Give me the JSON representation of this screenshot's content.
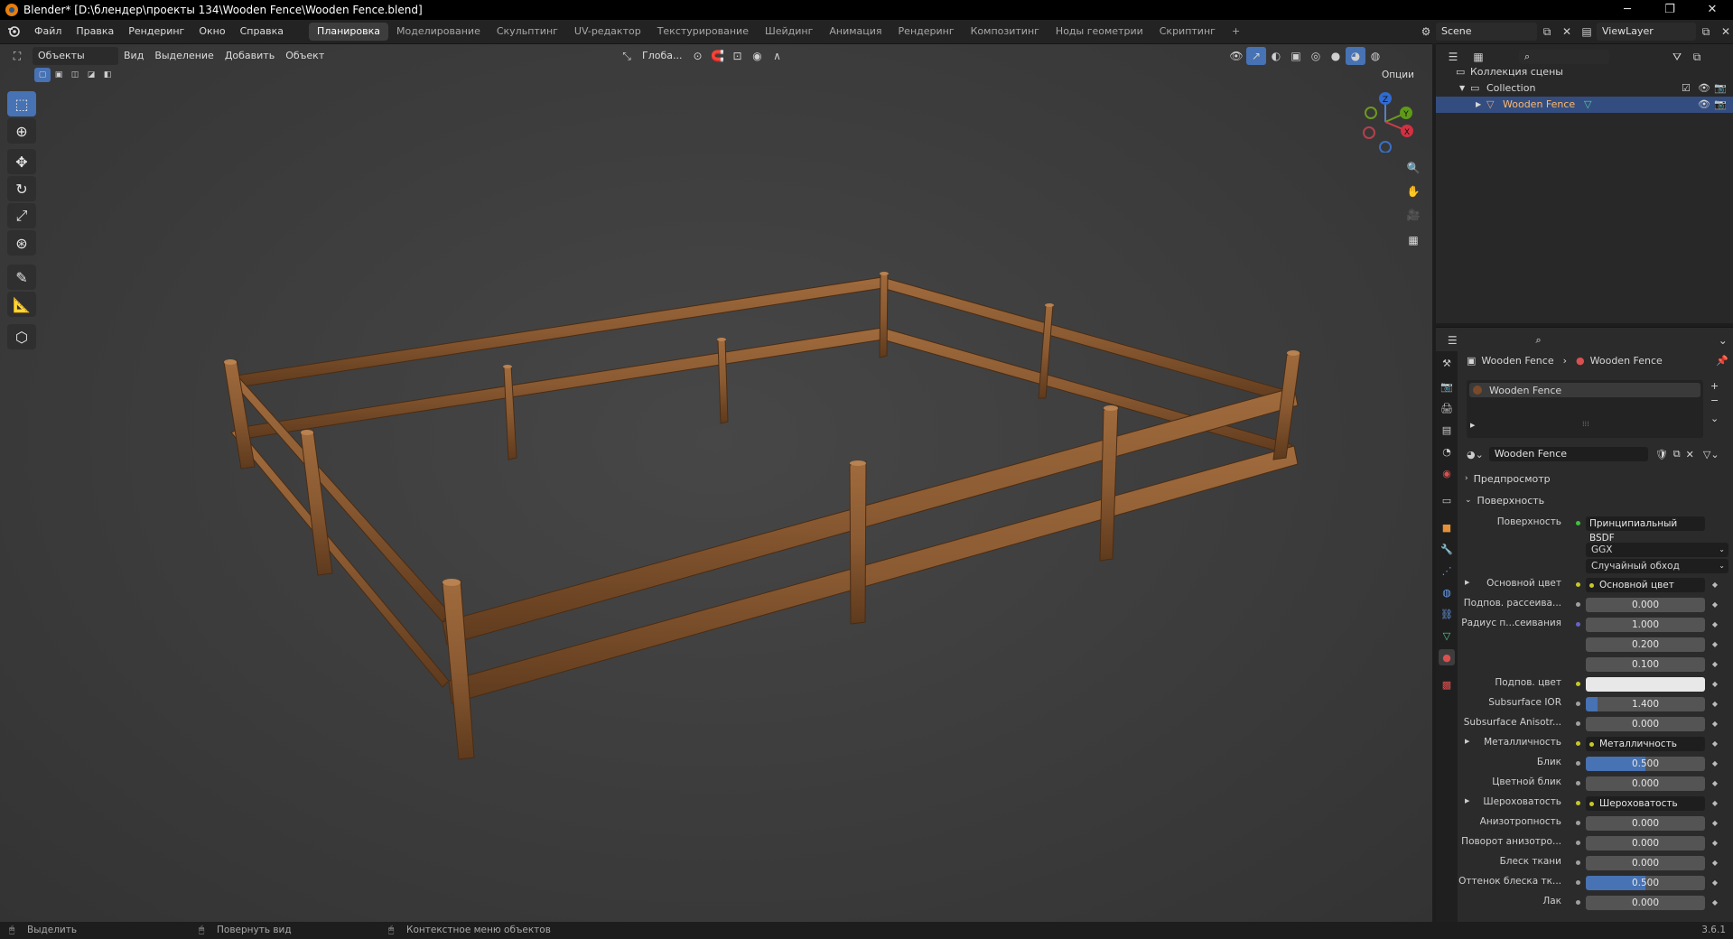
{
  "window": {
    "title": "Blender* [D:\\блендер\\проекты 134\\Wooden Fence\\Wooden Fence.blend]",
    "minimize": "─",
    "maximize": "❐",
    "close": "✕"
  },
  "menu": [
    "Файл",
    "Правка",
    "Рендеринг",
    "Окно",
    "Справка"
  ],
  "workspaces": [
    "Планировка",
    "Моделирование",
    "Скульптинг",
    "UV-редактор",
    "Текстурирование",
    "Шейдинг",
    "Анимация",
    "Рендеринг",
    "Композитинг",
    "Ноды геометрии",
    "Скриптинг"
  ],
  "workspace_add": "+",
  "scene": {
    "name": "Scene",
    "view_layer": "ViewLayer"
  },
  "viewport_header": {
    "mode": "Объекты",
    "menus": [
      "Вид",
      "Выделение",
      "Добавить",
      "Объект"
    ],
    "orientation": "Глоба...",
    "options": "Опции"
  },
  "outliner": {
    "scene_collection": "Коллекция сцены",
    "collection": "Collection",
    "object": "Wooden Fence"
  },
  "properties": {
    "breadcrumb_object": "Wooden Fence",
    "breadcrumb_material": "Wooden Fence",
    "slot_name": "Wooden Fence",
    "material_name": "Wooden Fence",
    "panel_preview": "Предпросмотр",
    "panel_surface": "Поверхность",
    "surface_label": "Поверхность",
    "surface_value": "Принципиальный BSDF",
    "distribution": "GGX",
    "subsurface_method": "Случайный обход",
    "rows": [
      {
        "label": "Основной цвет",
        "type": "link",
        "value": "Основной цвет",
        "expand": true
      },
      {
        "label": "Подпов. рассеива...",
        "type": "num",
        "value": "0.000"
      },
      {
        "label": "Радиус п...сеивания",
        "type": "num",
        "value": "1.000",
        "dot": "#6363c7"
      },
      {
        "label": "",
        "type": "num",
        "value": "0.200"
      },
      {
        "label": "",
        "type": "num",
        "value": "0.100"
      },
      {
        "label": "Подпов. цвет",
        "type": "color",
        "value": "",
        "dot": "#c7c729"
      },
      {
        "label": "Subsurface IOR",
        "type": "num",
        "value": "1.400",
        "fill": 0.1
      },
      {
        "label": "Subsurface Anisotr...",
        "type": "num",
        "value": "0.000"
      },
      {
        "label": "Металличность",
        "type": "link",
        "value": "Металличность",
        "expand": true
      },
      {
        "label": "Блик",
        "type": "num",
        "value": "0.500",
        "fill": 0.5
      },
      {
        "label": "Цветной блик",
        "type": "num",
        "value": "0.000"
      },
      {
        "label": "Шероховатость",
        "type": "link",
        "value": "Шероховатость",
        "expand": true
      },
      {
        "label": "Анизотропность",
        "type": "num",
        "value": "0.000"
      },
      {
        "label": "Поворот анизотро...",
        "type": "num",
        "value": "0.000"
      },
      {
        "label": "Блеск ткани",
        "type": "num",
        "value": "0.000"
      },
      {
        "label": "Оттенок блеска тк...",
        "type": "num",
        "value": "0.500",
        "fill": 0.5
      },
      {
        "label": "Лак",
        "type": "num",
        "value": "0.000"
      }
    ]
  },
  "statusbar": {
    "select": "Выделить",
    "rotate": "Повернуть вид",
    "context": "Контекстное меню объектов",
    "version": "3.6.1"
  },
  "gizmo": {
    "x": "X",
    "y": "Y",
    "z": "Z"
  },
  "colors": {
    "accent": "#4772b3",
    "wood": "#8a5a32",
    "wood_dark": "#5e3a1d",
    "selected_row": "#334d80"
  }
}
